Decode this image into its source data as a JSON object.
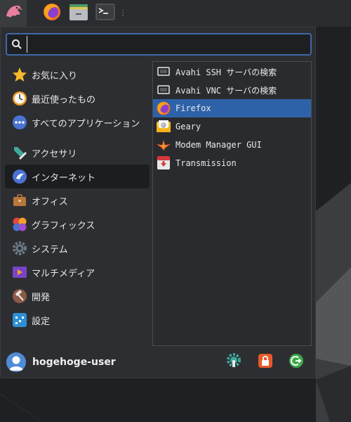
{
  "panel": {
    "items": [
      {
        "icon": "whisker-menu-icon"
      },
      {
        "icon": "firefox-icon"
      },
      {
        "icon": "file-manager-icon"
      },
      {
        "icon": "terminal-icon"
      }
    ]
  },
  "search": {
    "value": "",
    "placeholder": ""
  },
  "categories": [
    {
      "label": "お気に入り",
      "icon": "star-icon"
    },
    {
      "label": "最近使ったもの",
      "icon": "clock-icon"
    },
    {
      "label": "すべてのアプリケーション",
      "icon": "grid-dots-icon"
    },
    {
      "label": "アクセサリ",
      "icon": "accessories-icon"
    },
    {
      "label": "インターネット",
      "icon": "internet-icon",
      "active": true
    },
    {
      "label": "オフィス",
      "icon": "briefcase-icon"
    },
    {
      "label": "グラフィックス",
      "icon": "graphics-icon"
    },
    {
      "label": "システム",
      "icon": "gear-icon"
    },
    {
      "label": "マルチメディア",
      "icon": "multimedia-icon"
    },
    {
      "label": "開発",
      "icon": "hammer-icon"
    },
    {
      "label": "設定",
      "icon": "settings-icon"
    }
  ],
  "apps": [
    {
      "label": "Avahi SSH サーバの検索",
      "icon": "network-icon"
    },
    {
      "label": "Avahi VNC サーバの検索",
      "icon": "network-icon"
    },
    {
      "label": "Firefox",
      "icon": "firefox-icon",
      "selected": true
    },
    {
      "label": "Geary",
      "icon": "mail-icon"
    },
    {
      "label": "Modem Manager GUI",
      "icon": "modem-icon"
    },
    {
      "label": "Transmission",
      "icon": "transmission-icon"
    }
  ],
  "footer": {
    "username": "hogehoge-user",
    "buttons": [
      {
        "icon": "settings-manager-icon"
      },
      {
        "icon": "lock-icon"
      },
      {
        "icon": "logout-icon"
      }
    ]
  },
  "colors": {
    "accent": "#2d62a8",
    "search_border": "#3f68a8",
    "panel": "#2b2c2f",
    "menu_bg": "#2d2e31"
  }
}
